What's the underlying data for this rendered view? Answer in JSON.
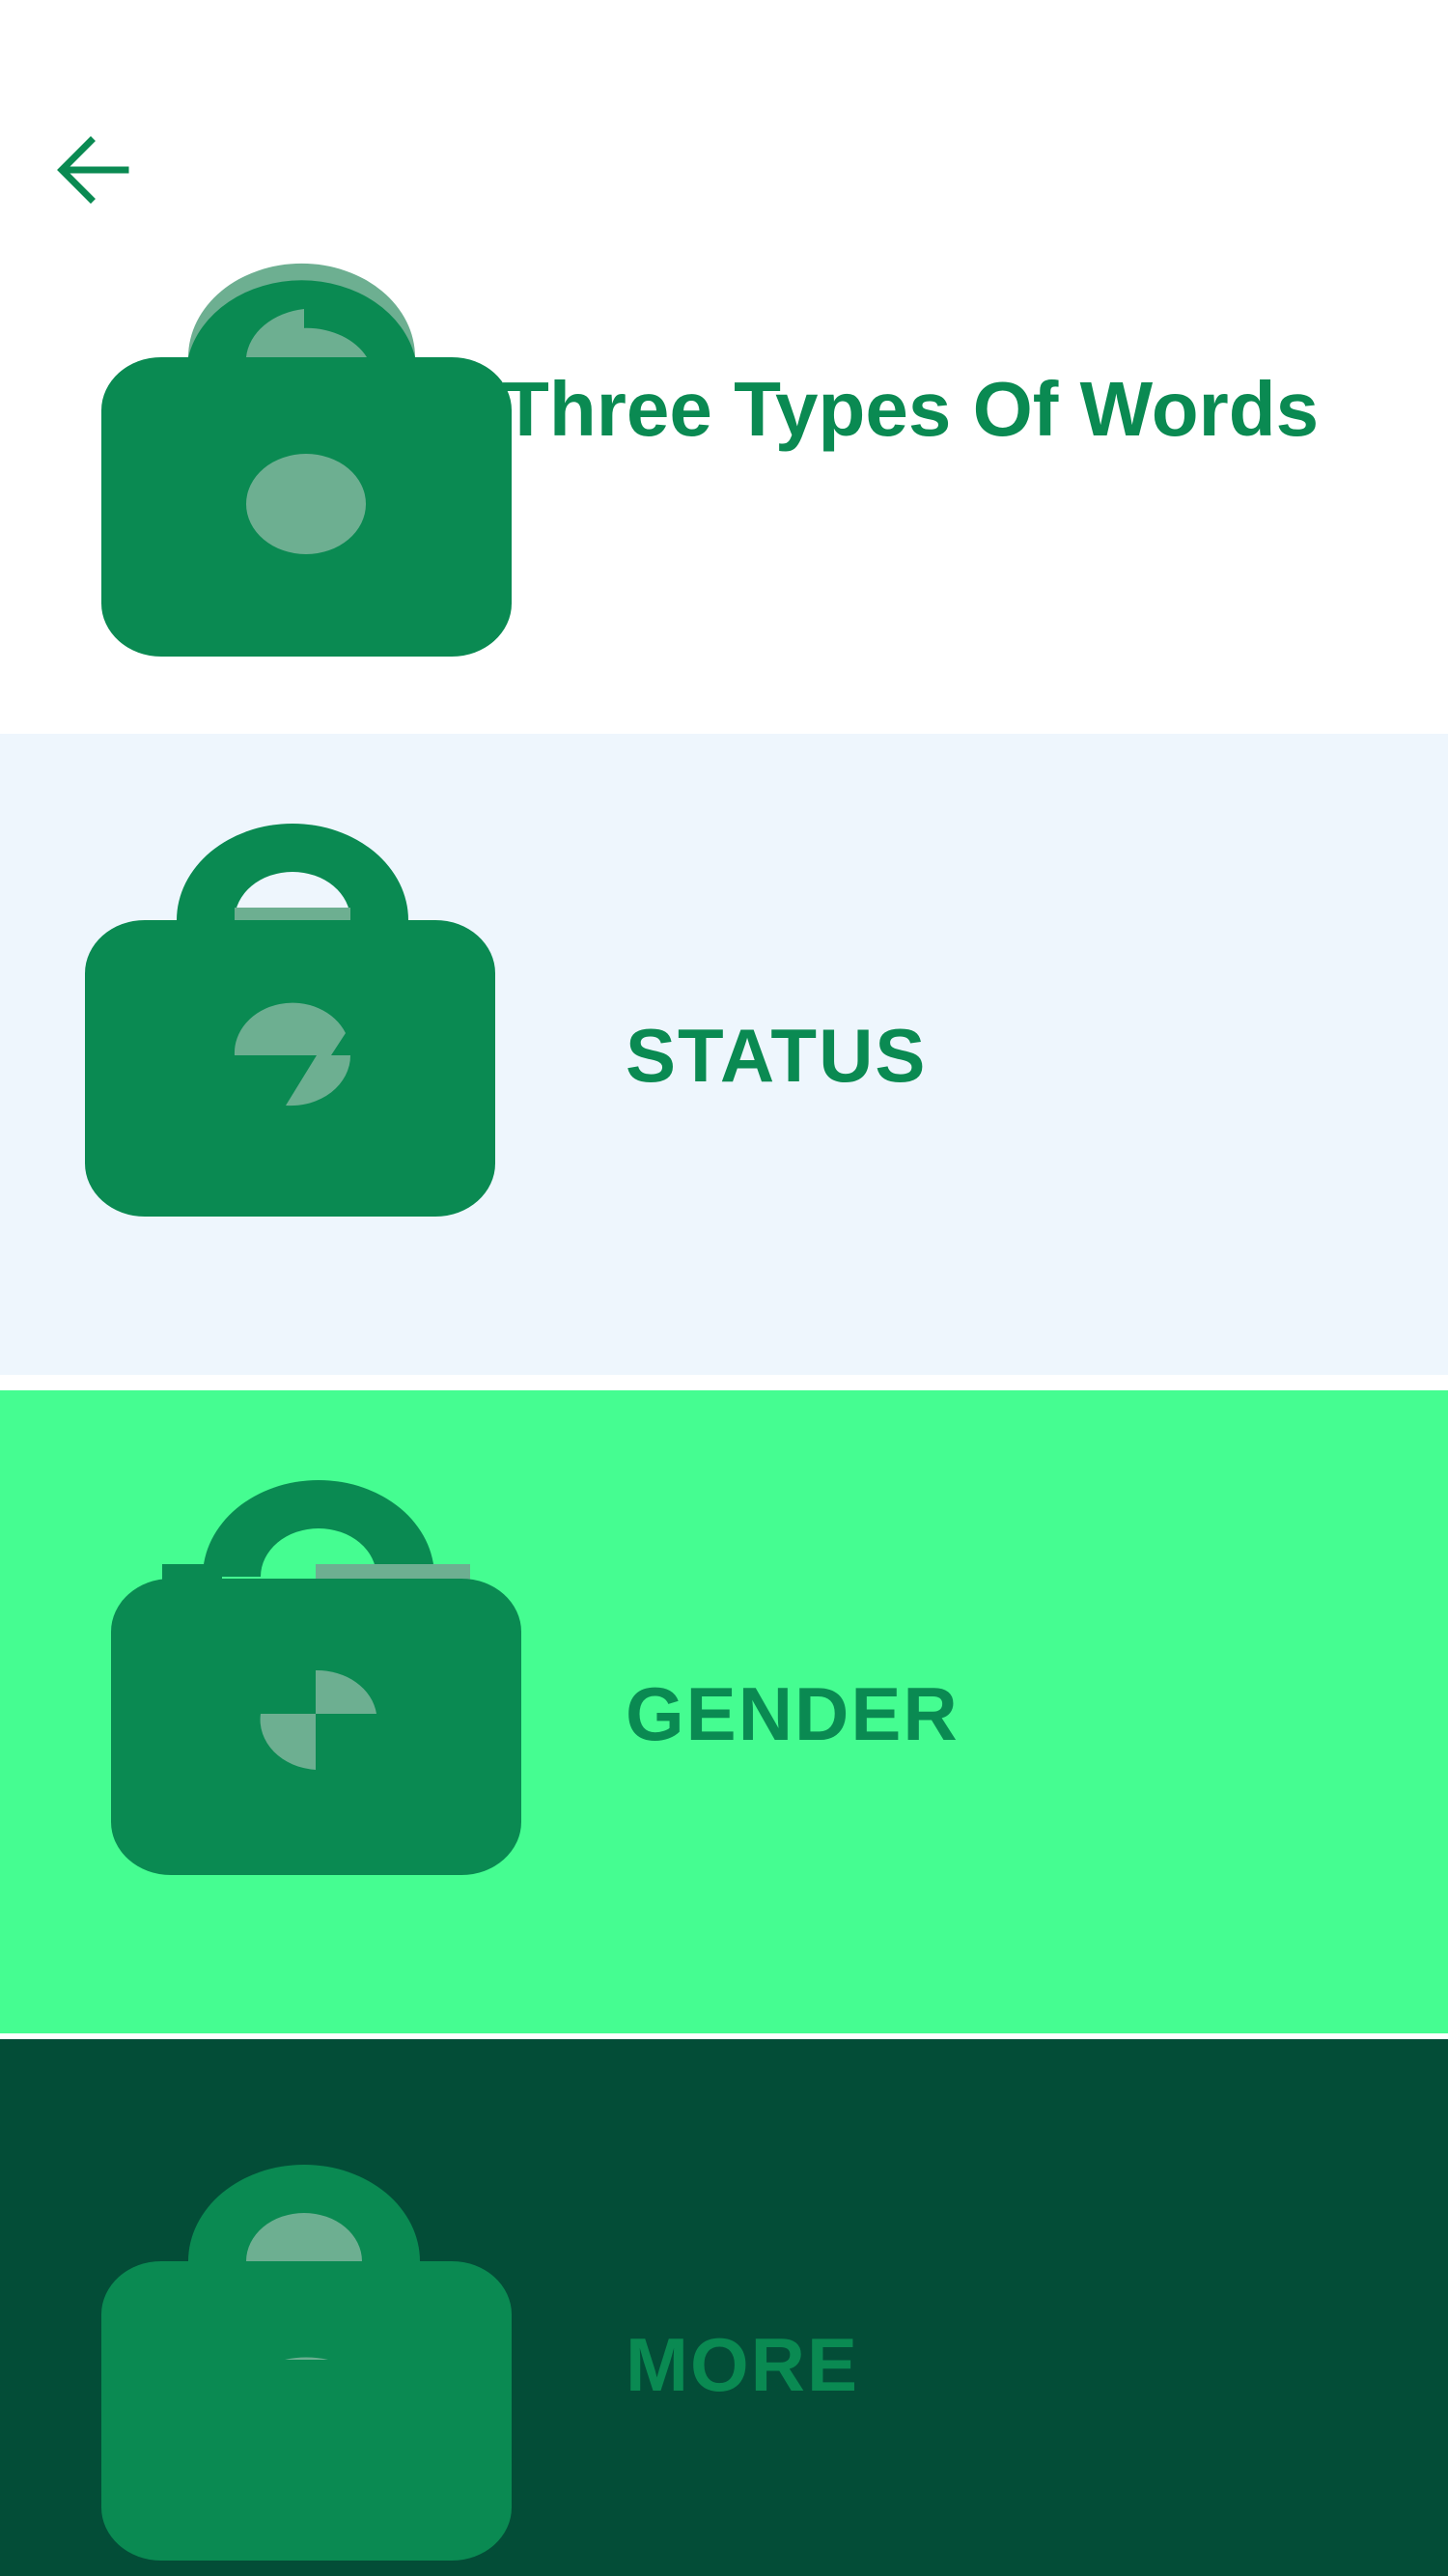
{
  "header": {
    "back_icon": "arrow-left-icon",
    "logo_icon": "shopping-bag-icon",
    "title": "Three Types Of Words"
  },
  "sections": [
    {
      "label": "STATUS",
      "icon": "shopping-bag-icon",
      "background": "#eef6fd"
    },
    {
      "label": "GENDER",
      "icon": "shopping-bag-icon",
      "background": "#45fd91"
    },
    {
      "label": "MORE",
      "icon": "shopping-bag-icon",
      "background": "#034d37"
    }
  ],
  "colors": {
    "accent": "#0a8a52",
    "icon_light": "#6daf91",
    "page_background": "#ffffff"
  }
}
